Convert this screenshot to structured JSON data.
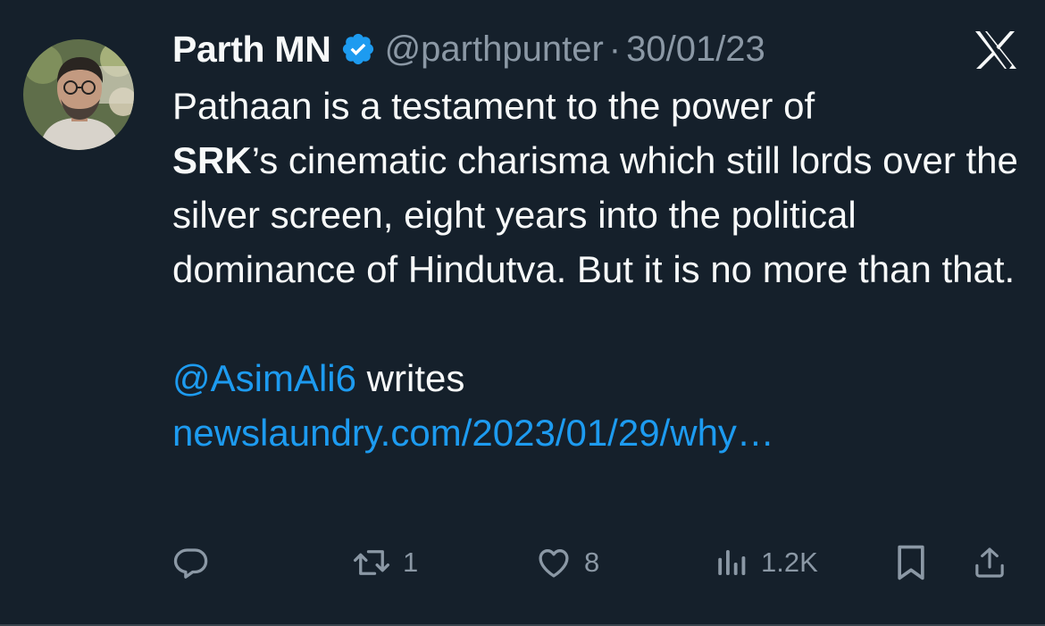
{
  "tweet": {
    "author_name": "Parth MN",
    "handle": "@parthpunter",
    "separator": "·",
    "date": "30/01/23",
    "body_line1": "Pathaan is a testament to the power of",
    "body_bold": "SRK",
    "body_rest": "’s cinematic charisma which still lords over the silver screen, eight years into the political dominance of Hindutva. But it is no more than that.",
    "mention": "@AsimAli6",
    "mention_suffix": " writes",
    "link": "newslaundry.com/2023/01/29/why…"
  },
  "actions": {
    "retweet_count": "1",
    "like_count": "8",
    "view_count": "1.2K"
  },
  "colors": {
    "background": "#15202b",
    "text": "#f7f9f9",
    "muted": "#8b98a5",
    "accent": "#1d9bf0",
    "verified": "#1d9bf0"
  },
  "icons": {
    "verified": "verified-badge-icon",
    "brand": "x-logo-icon",
    "reply": "reply-icon",
    "retweet": "retweet-icon",
    "like": "heart-icon",
    "views": "views-icon",
    "bookmark": "bookmark-icon",
    "share": "share-icon"
  }
}
